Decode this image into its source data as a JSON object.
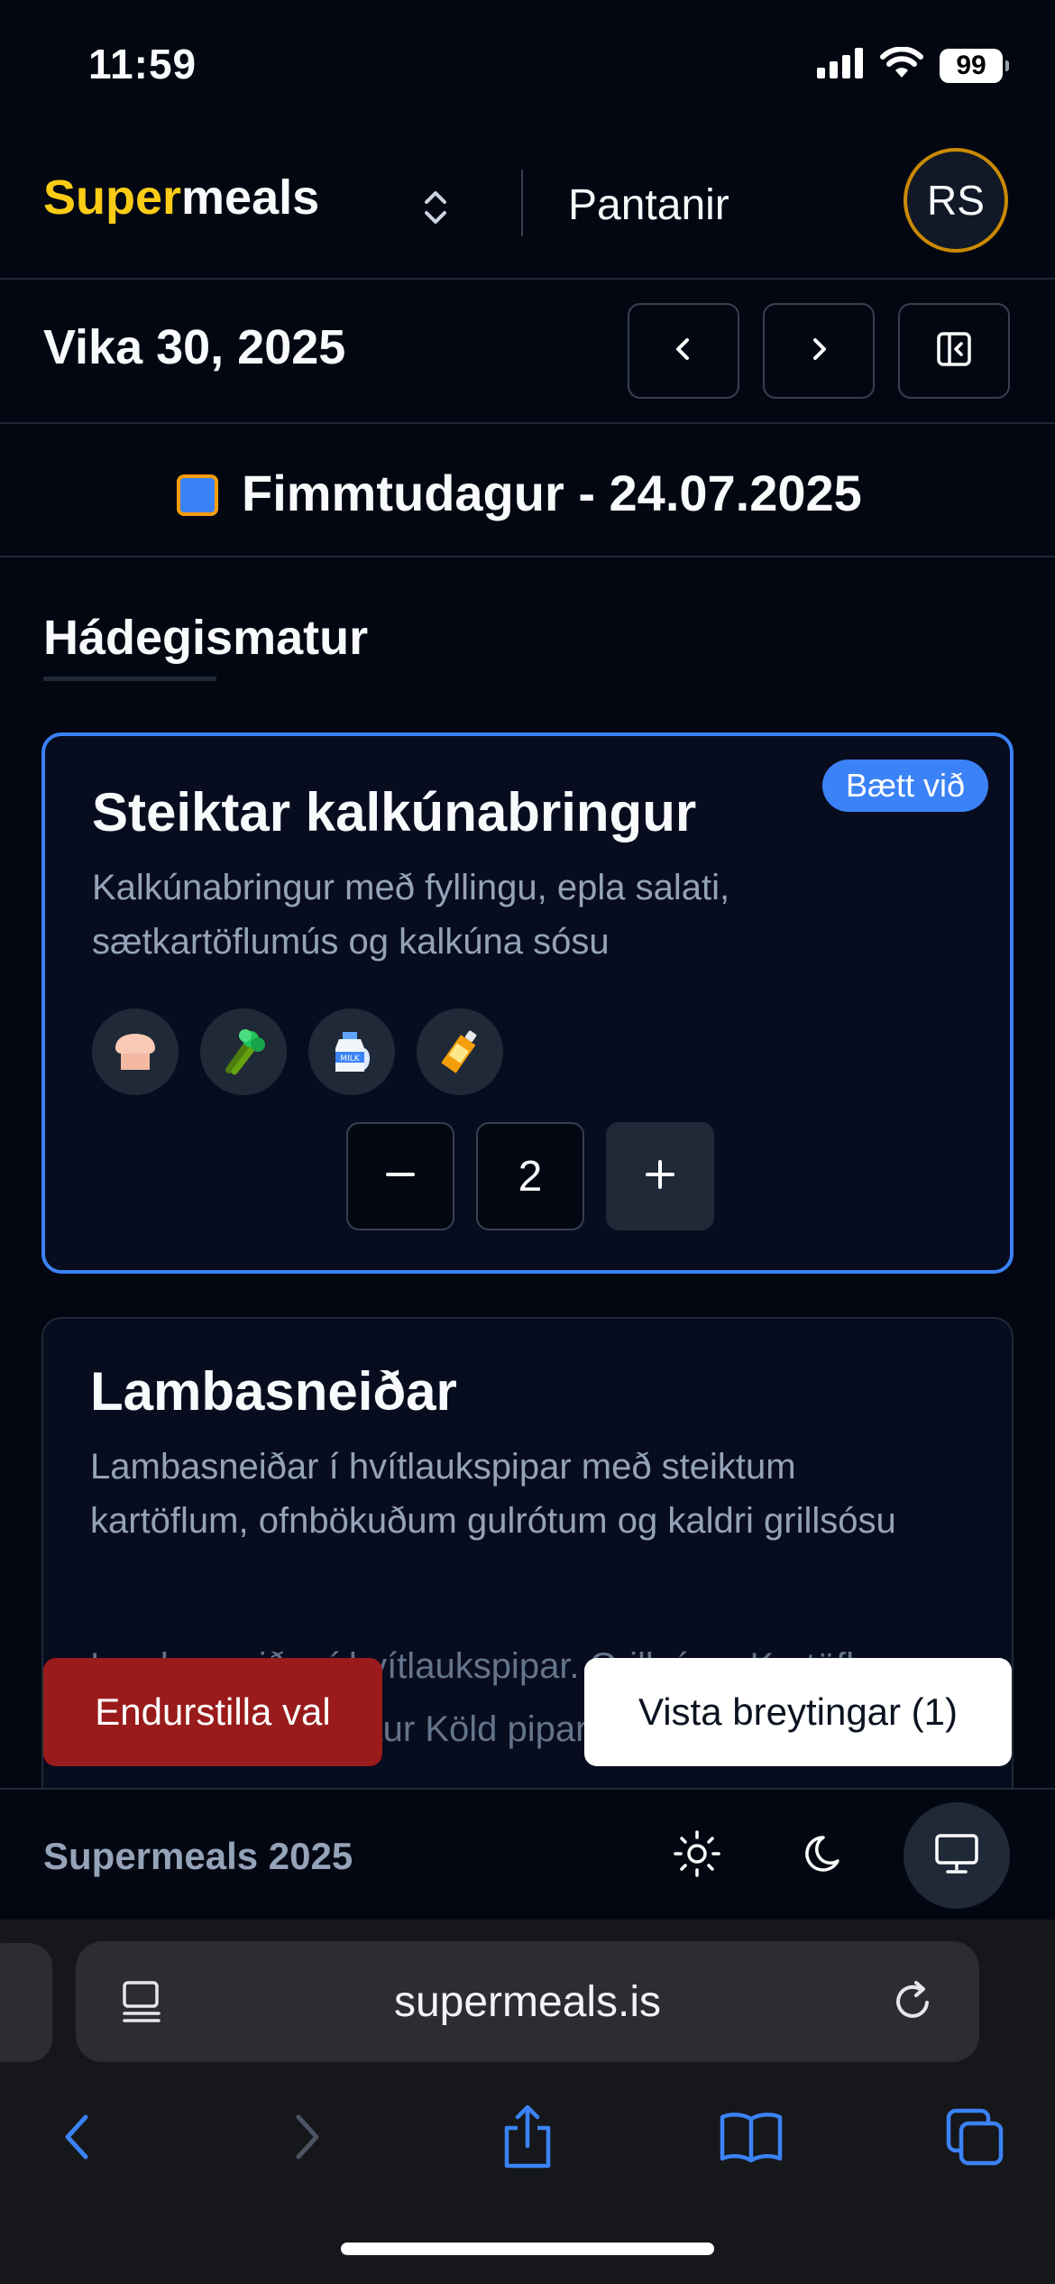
{
  "status_bar": {
    "time": "11:59",
    "battery": "99",
    "icons": [
      "signal-icon",
      "wifi-icon",
      "battery-icon"
    ]
  },
  "header": {
    "brand_part1": "Super",
    "brand_part2": "meals",
    "brand_color": "#facc15",
    "nav_link": "Pantanir",
    "avatar_initials": "RS"
  },
  "week": {
    "title": "Vika 30, 2025",
    "buttons": [
      "chevron-left-icon",
      "chevron-right-icon",
      "sidebar-toggle-icon"
    ]
  },
  "day": {
    "title": "Fimmtudagur - 24.07.2025"
  },
  "section": {
    "title": "Hádegismatur"
  },
  "meals": [
    {
      "name": "Steiktar kalkúnabringur",
      "description": "Kalkúnabringur með fyllingu, epla salati, sætkartöflumús og kalkúna sósu",
      "badge": "Bætt við",
      "allergens": [
        "bread-icon",
        "celery-icon",
        "milk-icon",
        "mustard-icon"
      ],
      "quantity": "2",
      "selected": true
    },
    {
      "name": "Lambasneiðar",
      "description": "Lambasneiðar í hvítlaukspipar með steiktum kartöflum, ofnbökuðum gulrótum og kaldri grillsósu",
      "partial_lines": [
        "Lambasneiðar í hvítlaukspipar. Grillsósa. Kartöflur,",
        "ofnbakaðar gulrætur Köld piparsósa"
      ],
      "selected": false
    }
  ],
  "actions": {
    "reset": "Endurstilla val",
    "save": "Vista breytingar (1)"
  },
  "footer": {
    "text": "Supermeals 2025",
    "theme_icons": [
      "sun-icon",
      "moon-icon",
      "monitor-icon"
    ]
  },
  "browser": {
    "url": "supermeals.is"
  }
}
